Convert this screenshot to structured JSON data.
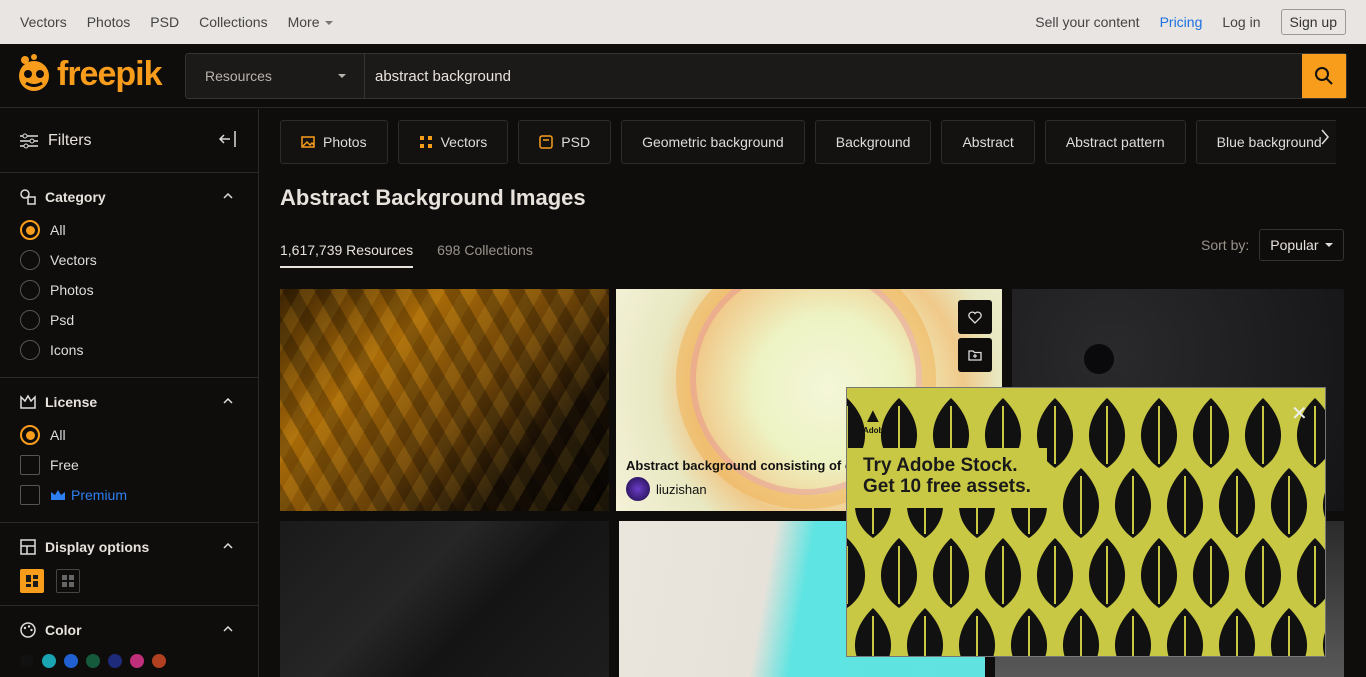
{
  "topnav": {
    "items": [
      "Vectors",
      "Photos",
      "PSD",
      "Collections",
      "More"
    ],
    "sell": "Sell your content",
    "pricing": "Pricing",
    "login": "Log in",
    "signup": "Sign up"
  },
  "header": {
    "logo": "freepik",
    "resource_type": "Resources",
    "search_value": "abstract background"
  },
  "sidebar": {
    "title": "Filters",
    "category": {
      "title": "Category",
      "options": [
        "All",
        "Vectors",
        "Photos",
        "Psd",
        "Icons"
      ],
      "selected": "All"
    },
    "license": {
      "title": "License",
      "options": [
        "All",
        "Free",
        "Premium"
      ],
      "selected": "All"
    },
    "display": {
      "title": "Display options"
    },
    "color": {
      "title": "Color",
      "swatches": [
        "#111111",
        "#1aa3b0",
        "#2060d0",
        "#155a3a",
        "#1e2a7a",
        "#c0307a",
        "#b04020"
      ]
    }
  },
  "main": {
    "chips": [
      "Photos",
      "Vectors",
      "PSD",
      "Geometric background",
      "Background",
      "Abstract",
      "Abstract pattern",
      "Blue background"
    ],
    "title": "Abstract Background Images",
    "tab_resources": "1,617,739 Resources",
    "tab_collections": "698 Collections",
    "sort_label": "Sort by:",
    "sort_value": "Popular",
    "card2": {
      "caption": "Abstract background consisting of colorful circles",
      "author": "liuzishan"
    }
  },
  "ad": {
    "brand": "Adobe",
    "line1": "Try Adobe Stock.",
    "line2": "Get 10 free assets."
  },
  "colors": {
    "accent": "#f89c1c",
    "background": "#0e0d0c",
    "link_blue": "#1c70e0",
    "ad_bg": "#c8c844"
  }
}
